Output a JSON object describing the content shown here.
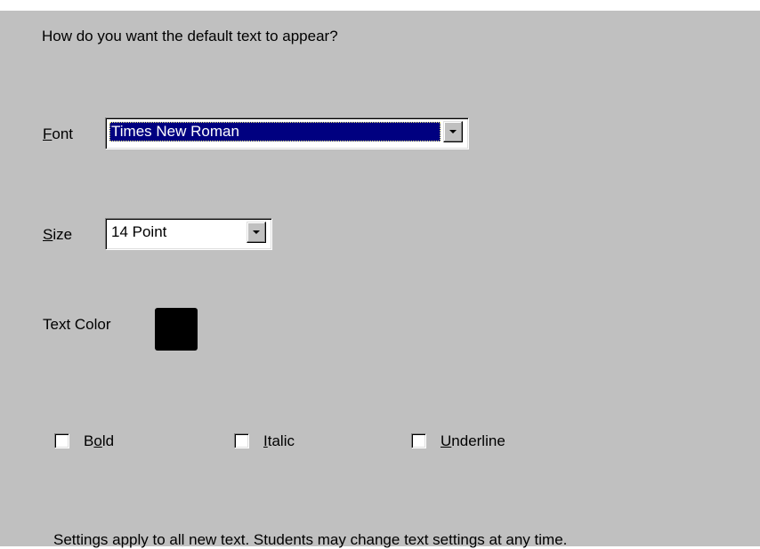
{
  "prompt": "How do you want the default text to appear?",
  "font": {
    "label_mnemonic": "F",
    "label_rest": "ont",
    "value": "Times New Roman"
  },
  "size": {
    "label_mnemonic": "S",
    "label_rest": "ize",
    "value": "14 Point"
  },
  "text_color": {
    "label": "Text Color",
    "value": "#000000"
  },
  "options": {
    "bold": {
      "pre": "B",
      "mnemonic": "o",
      "post": "ld",
      "checked": false
    },
    "italic": {
      "pre": "",
      "mnemonic": "I",
      "post": "talic",
      "checked": false
    },
    "underline": {
      "pre": "",
      "mnemonic": "U",
      "post": "nderline",
      "checked": false
    }
  },
  "note": "Settings apply to all new text. Students may change text settings at any time.",
  "colors": {
    "panel_bg": "#c0c0c0",
    "selection_bg": "#000080",
    "selection_text": "#ffffff"
  },
  "icons": {
    "dropdown": "chevron-down-icon"
  }
}
